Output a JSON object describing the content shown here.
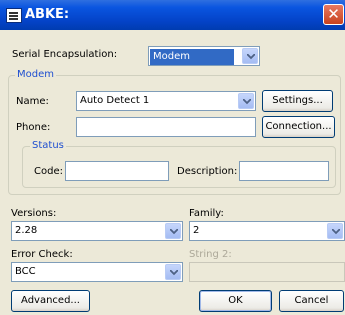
{
  "window": {
    "title": "ABKE:"
  },
  "serial": {
    "label": "Serial Encapsulation:",
    "value": "Modem"
  },
  "modem": {
    "group_label": "Modem",
    "name_label": "Name:",
    "name_value": "Auto Detect 1",
    "settings_button": "Settings...",
    "phone_label": "Phone:",
    "phone_value": "",
    "connection_button": "Connection...",
    "status": {
      "group_label": "Status",
      "code_label": "Code:",
      "code_value": "",
      "description_label": "Description:",
      "description_value": ""
    }
  },
  "versions": {
    "label": "Versions:",
    "value": "2.28"
  },
  "family": {
    "label": "Family:",
    "value": "2"
  },
  "error_check": {
    "label": "Error Check:",
    "value": "BCC"
  },
  "string2": {
    "label": "String 2:",
    "value": ""
  },
  "buttons": {
    "advanced": "Advanced...",
    "ok": "OK",
    "cancel": "Cancel"
  },
  "colors": {
    "titlebar": "#0a55e0",
    "dialog_bg": "#ECE9D8",
    "group_label": "#1f4fd0",
    "selection": "#316ac5"
  },
  "icons": {
    "title": "app-window-icon",
    "close": "close-icon",
    "dropdown": "chevron-down-icon"
  }
}
